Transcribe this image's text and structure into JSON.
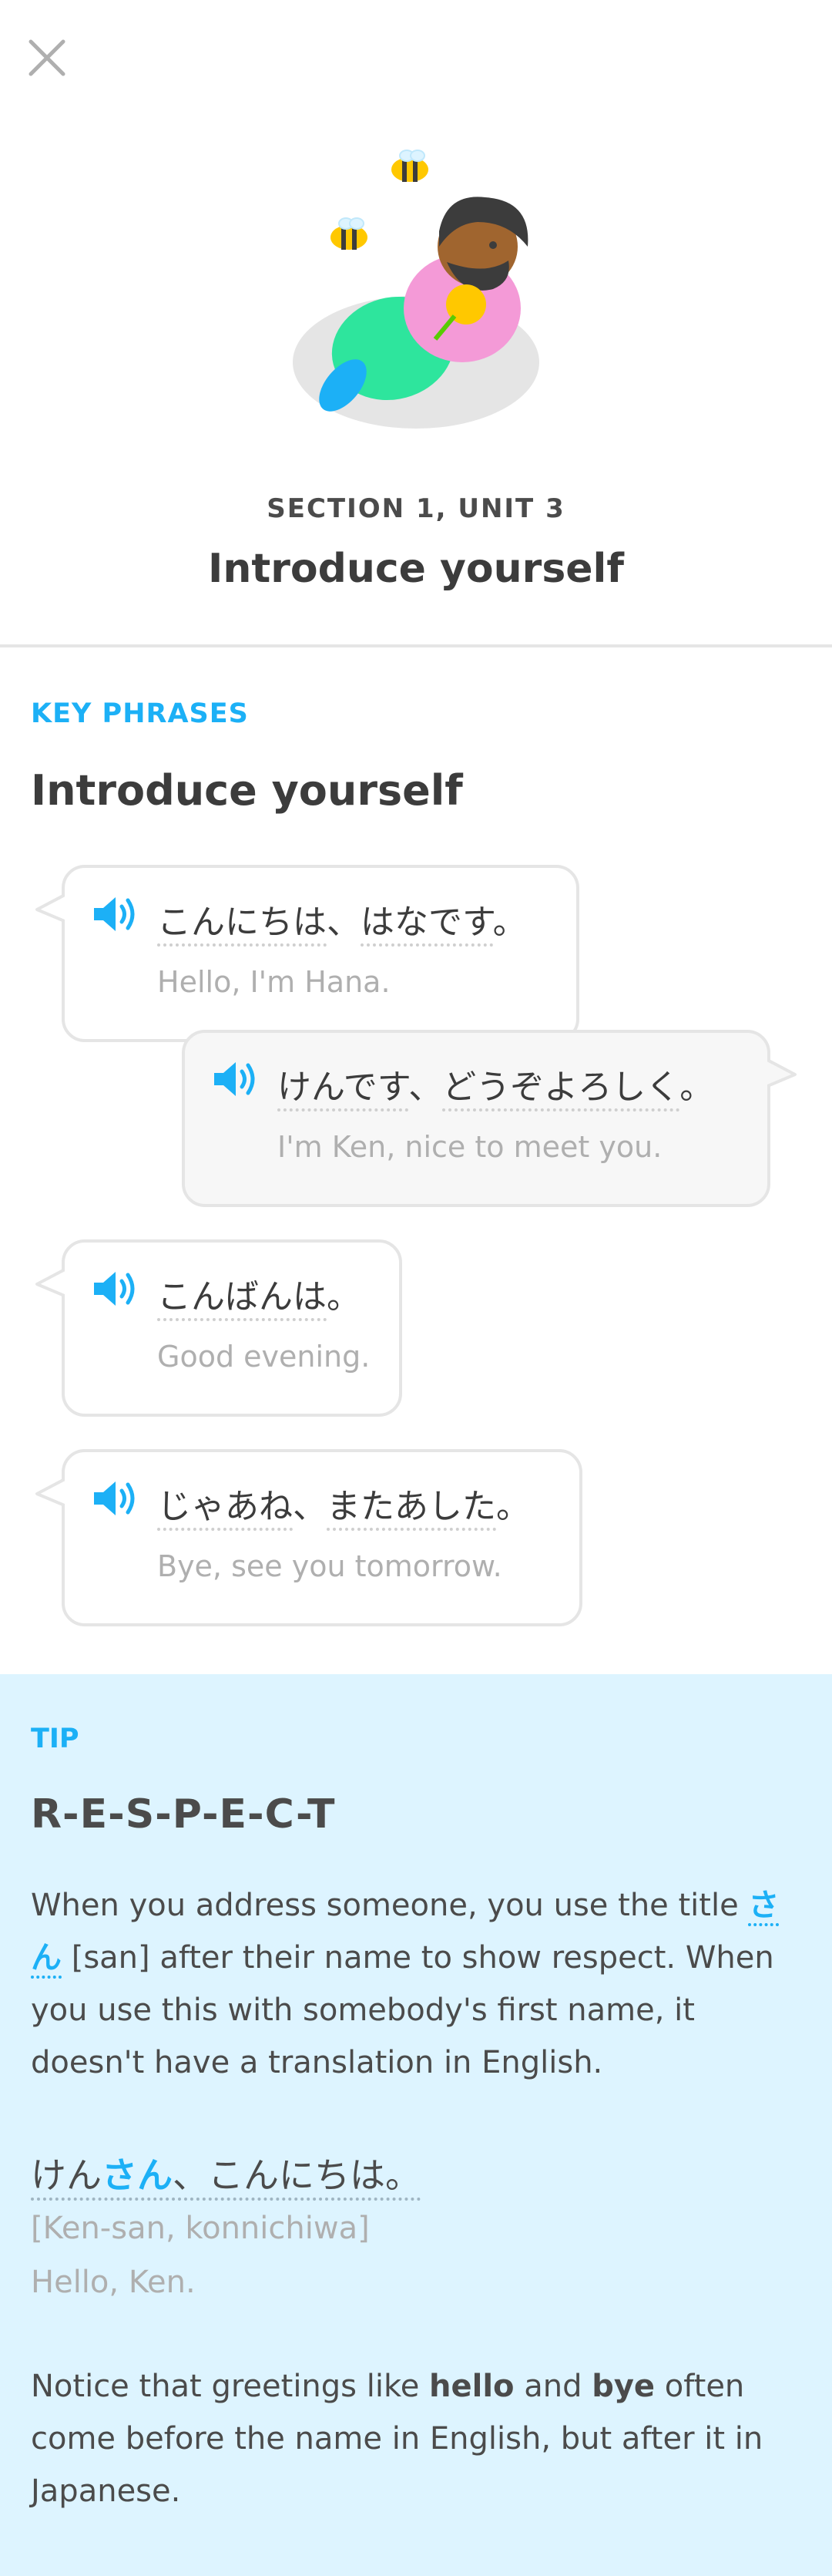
{
  "header": {
    "close_icon": "close-icon"
  },
  "unit": {
    "section_label": "SECTION 1, UNIT 3",
    "title": "Introduce yourself"
  },
  "key_phrases": {
    "label": "KEY PHRASES",
    "title": "Introduce yourself",
    "phrases": [
      {
        "jp_parts": [
          "こんにちは",
          "、",
          "はなです",
          "。"
        ],
        "en": "Hello, I'm Hana."
      },
      {
        "jp_parts": [
          "けんです",
          "、",
          "どうぞよろしく",
          "。"
        ],
        "en": "I'm Ken, nice to meet you."
      },
      {
        "jp_parts": [
          "こんばんは",
          "。"
        ],
        "en": "Good evening."
      },
      {
        "jp_parts": [
          "じゃあね",
          "、",
          "またあした",
          "。"
        ],
        "en": "Bye, see you tomorrow."
      }
    ]
  },
  "tip": {
    "label": "TIP",
    "title": "R-E-S-P-E-C-T",
    "p1_before": "When you address someone, you use the title ",
    "p1_kana": "さん",
    "p1_after": " [san] after their name to show respect. When you use this with somebody's first name, it doesn't have a translation in English.",
    "example": {
      "jp_pre": "けん",
      "jp_hl": "さん",
      "jp_post": "、こんにちは。",
      "romaji": "[Ken-san, konnichiwa]",
      "en": "Hello, Ken."
    },
    "p2_1": "Notice that greetings like ",
    "p2_b1": "hello",
    "p2_2": " and ",
    "p2_b2": "bye",
    "p2_3": " often come before the name in English, but after it in Japanese."
  },
  "colors": {
    "accent": "#1cb0f6",
    "tip_bg": "#ddf4ff",
    "text": "#4b4b4b",
    "muted": "#afafaf"
  }
}
